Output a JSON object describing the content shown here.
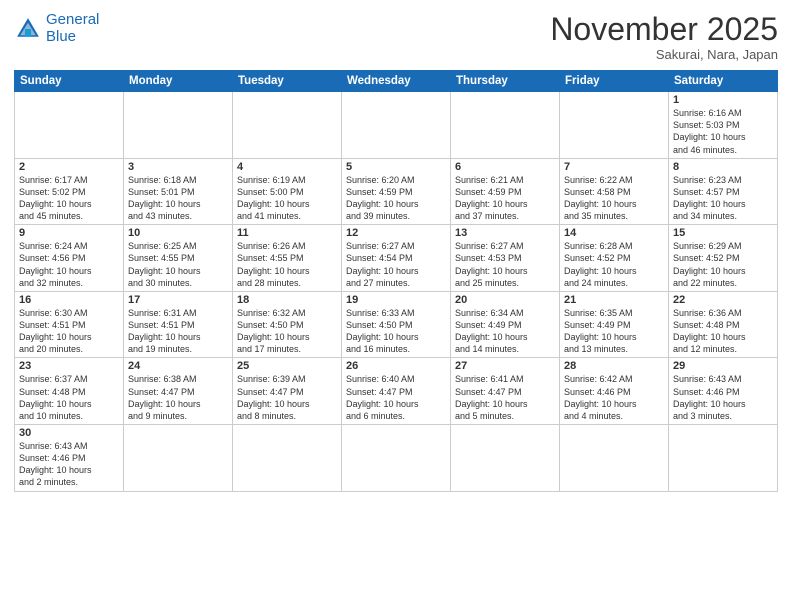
{
  "logo": {
    "line1": "General",
    "line2": "Blue"
  },
  "title": "November 2025",
  "location": "Sakurai, Nara, Japan",
  "weekdays": [
    "Sunday",
    "Monday",
    "Tuesday",
    "Wednesday",
    "Thursday",
    "Friday",
    "Saturday"
  ],
  "weeks": [
    [
      {
        "day": "",
        "info": "",
        "empty": true
      },
      {
        "day": "",
        "info": "",
        "empty": true
      },
      {
        "day": "",
        "info": "",
        "empty": true
      },
      {
        "day": "",
        "info": "",
        "empty": true
      },
      {
        "day": "",
        "info": "",
        "empty": true
      },
      {
        "day": "",
        "info": "",
        "empty": true
      },
      {
        "day": "1",
        "info": "Sunrise: 6:16 AM\nSunset: 5:03 PM\nDaylight: 10 hours\nand 46 minutes."
      }
    ],
    [
      {
        "day": "2",
        "info": "Sunrise: 6:17 AM\nSunset: 5:02 PM\nDaylight: 10 hours\nand 45 minutes."
      },
      {
        "day": "3",
        "info": "Sunrise: 6:18 AM\nSunset: 5:01 PM\nDaylight: 10 hours\nand 43 minutes."
      },
      {
        "day": "4",
        "info": "Sunrise: 6:19 AM\nSunset: 5:00 PM\nDaylight: 10 hours\nand 41 minutes."
      },
      {
        "day": "5",
        "info": "Sunrise: 6:20 AM\nSunset: 4:59 PM\nDaylight: 10 hours\nand 39 minutes."
      },
      {
        "day": "6",
        "info": "Sunrise: 6:21 AM\nSunset: 4:59 PM\nDaylight: 10 hours\nand 37 minutes."
      },
      {
        "day": "7",
        "info": "Sunrise: 6:22 AM\nSunset: 4:58 PM\nDaylight: 10 hours\nand 35 minutes."
      },
      {
        "day": "8",
        "info": "Sunrise: 6:23 AM\nSunset: 4:57 PM\nDaylight: 10 hours\nand 34 minutes."
      }
    ],
    [
      {
        "day": "9",
        "info": "Sunrise: 6:24 AM\nSunset: 4:56 PM\nDaylight: 10 hours\nand 32 minutes."
      },
      {
        "day": "10",
        "info": "Sunrise: 6:25 AM\nSunset: 4:55 PM\nDaylight: 10 hours\nand 30 minutes."
      },
      {
        "day": "11",
        "info": "Sunrise: 6:26 AM\nSunset: 4:55 PM\nDaylight: 10 hours\nand 28 minutes."
      },
      {
        "day": "12",
        "info": "Sunrise: 6:27 AM\nSunset: 4:54 PM\nDaylight: 10 hours\nand 27 minutes."
      },
      {
        "day": "13",
        "info": "Sunrise: 6:27 AM\nSunset: 4:53 PM\nDaylight: 10 hours\nand 25 minutes."
      },
      {
        "day": "14",
        "info": "Sunrise: 6:28 AM\nSunset: 4:52 PM\nDaylight: 10 hours\nand 24 minutes."
      },
      {
        "day": "15",
        "info": "Sunrise: 6:29 AM\nSunset: 4:52 PM\nDaylight: 10 hours\nand 22 minutes."
      }
    ],
    [
      {
        "day": "16",
        "info": "Sunrise: 6:30 AM\nSunset: 4:51 PM\nDaylight: 10 hours\nand 20 minutes."
      },
      {
        "day": "17",
        "info": "Sunrise: 6:31 AM\nSunset: 4:51 PM\nDaylight: 10 hours\nand 19 minutes."
      },
      {
        "day": "18",
        "info": "Sunrise: 6:32 AM\nSunset: 4:50 PM\nDaylight: 10 hours\nand 17 minutes."
      },
      {
        "day": "19",
        "info": "Sunrise: 6:33 AM\nSunset: 4:50 PM\nDaylight: 10 hours\nand 16 minutes."
      },
      {
        "day": "20",
        "info": "Sunrise: 6:34 AM\nSunset: 4:49 PM\nDaylight: 10 hours\nand 14 minutes."
      },
      {
        "day": "21",
        "info": "Sunrise: 6:35 AM\nSunset: 4:49 PM\nDaylight: 10 hours\nand 13 minutes."
      },
      {
        "day": "22",
        "info": "Sunrise: 6:36 AM\nSunset: 4:48 PM\nDaylight: 10 hours\nand 12 minutes."
      }
    ],
    [
      {
        "day": "23",
        "info": "Sunrise: 6:37 AM\nSunset: 4:48 PM\nDaylight: 10 hours\nand 10 minutes."
      },
      {
        "day": "24",
        "info": "Sunrise: 6:38 AM\nSunset: 4:47 PM\nDaylight: 10 hours\nand 9 minutes."
      },
      {
        "day": "25",
        "info": "Sunrise: 6:39 AM\nSunset: 4:47 PM\nDaylight: 10 hours\nand 8 minutes."
      },
      {
        "day": "26",
        "info": "Sunrise: 6:40 AM\nSunset: 4:47 PM\nDaylight: 10 hours\nand 6 minutes."
      },
      {
        "day": "27",
        "info": "Sunrise: 6:41 AM\nSunset: 4:47 PM\nDaylight: 10 hours\nand 5 minutes."
      },
      {
        "day": "28",
        "info": "Sunrise: 6:42 AM\nSunset: 4:46 PM\nDaylight: 10 hours\nand 4 minutes."
      },
      {
        "day": "29",
        "info": "Sunrise: 6:43 AM\nSunset: 4:46 PM\nDaylight: 10 hours\nand 3 minutes."
      }
    ],
    [
      {
        "day": "30",
        "info": "Sunrise: 6:43 AM\nSunset: 4:46 PM\nDaylight: 10 hours\nand 2 minutes."
      },
      {
        "day": "",
        "info": "",
        "empty": true
      },
      {
        "day": "",
        "info": "",
        "empty": true
      },
      {
        "day": "",
        "info": "",
        "empty": true
      },
      {
        "day": "",
        "info": "",
        "empty": true
      },
      {
        "day": "",
        "info": "",
        "empty": true
      },
      {
        "day": "",
        "info": "",
        "empty": true
      }
    ]
  ]
}
